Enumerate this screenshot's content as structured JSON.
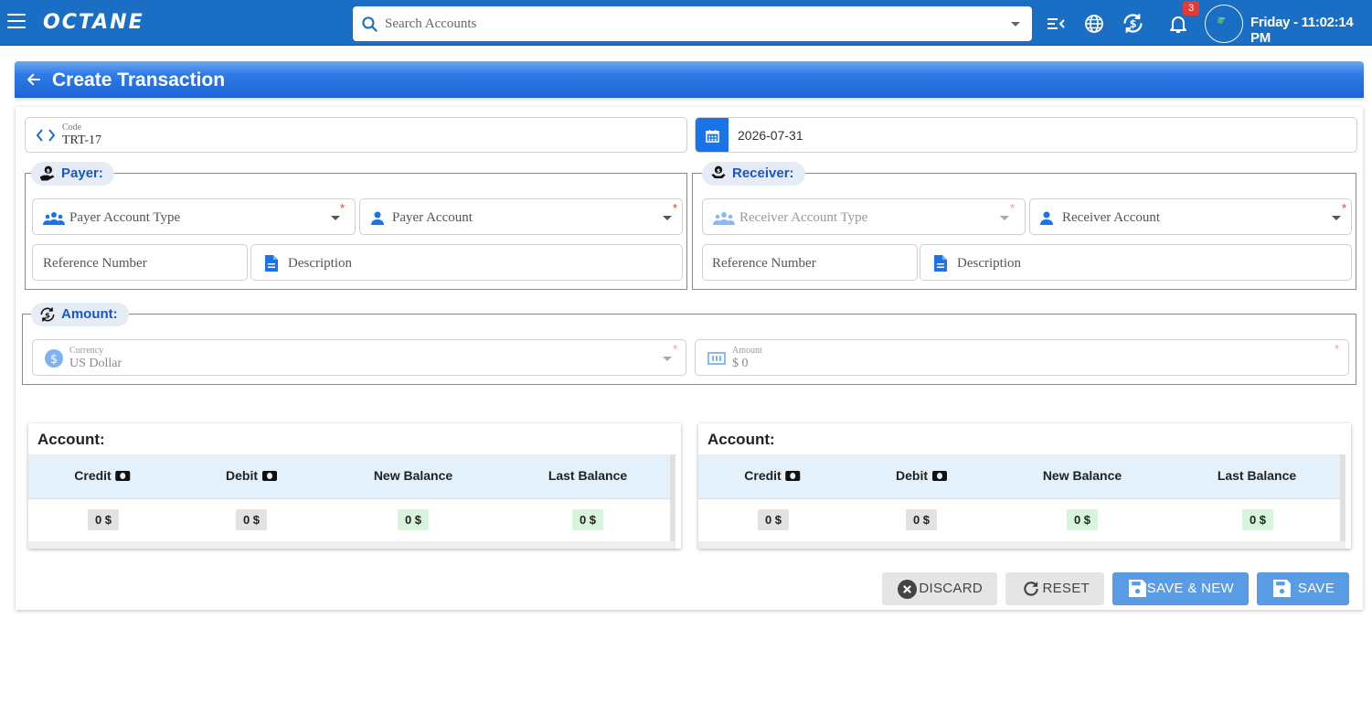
{
  "topbar": {
    "logo": "OCTANE",
    "search_placeholder": "Search Accounts",
    "notification_count": "3",
    "clock": "Friday - 11:02:14 PM",
    "brand_color": "#1a6fc4"
  },
  "page": {
    "title": "Create Transaction"
  },
  "form": {
    "code_label": "Code",
    "code_value": "TRT-17",
    "date_value": "2026-07-31",
    "payer": {
      "legend": "Payer:",
      "account_type_placeholder": "Payer Account Type",
      "account_placeholder": "Payer Account",
      "reference_placeholder": "Reference Number",
      "description_placeholder": "Description"
    },
    "receiver": {
      "legend": "Receiver:",
      "account_type_placeholder": "Receiver Account Type",
      "account_placeholder": "Receiver Account",
      "reference_placeholder": "Reference Number",
      "description_placeholder": "Description"
    },
    "amount": {
      "legend": "Amount:",
      "currency_label": "Currency",
      "currency_value": "US Dollar",
      "amount_label": "Amount",
      "amount_value": "$ 0"
    },
    "required_mark": "*"
  },
  "accounts": [
    {
      "title": "Account:",
      "headers": [
        "Credit",
        "Debit",
        "New Balance",
        "Last Balance"
      ],
      "values": [
        "0 $",
        "0 $",
        "0 $",
        "0 $"
      ]
    },
    {
      "title": "Account:",
      "headers": [
        "Credit",
        "Debit",
        "New Balance",
        "Last Balance"
      ],
      "values": [
        "0 $",
        "0 $",
        "0 $",
        "0 $"
      ]
    }
  ],
  "buttons": {
    "discard": "DISCARD",
    "reset": "RESET",
    "save_new": "SAVE & NEW",
    "save": "SAVE"
  }
}
